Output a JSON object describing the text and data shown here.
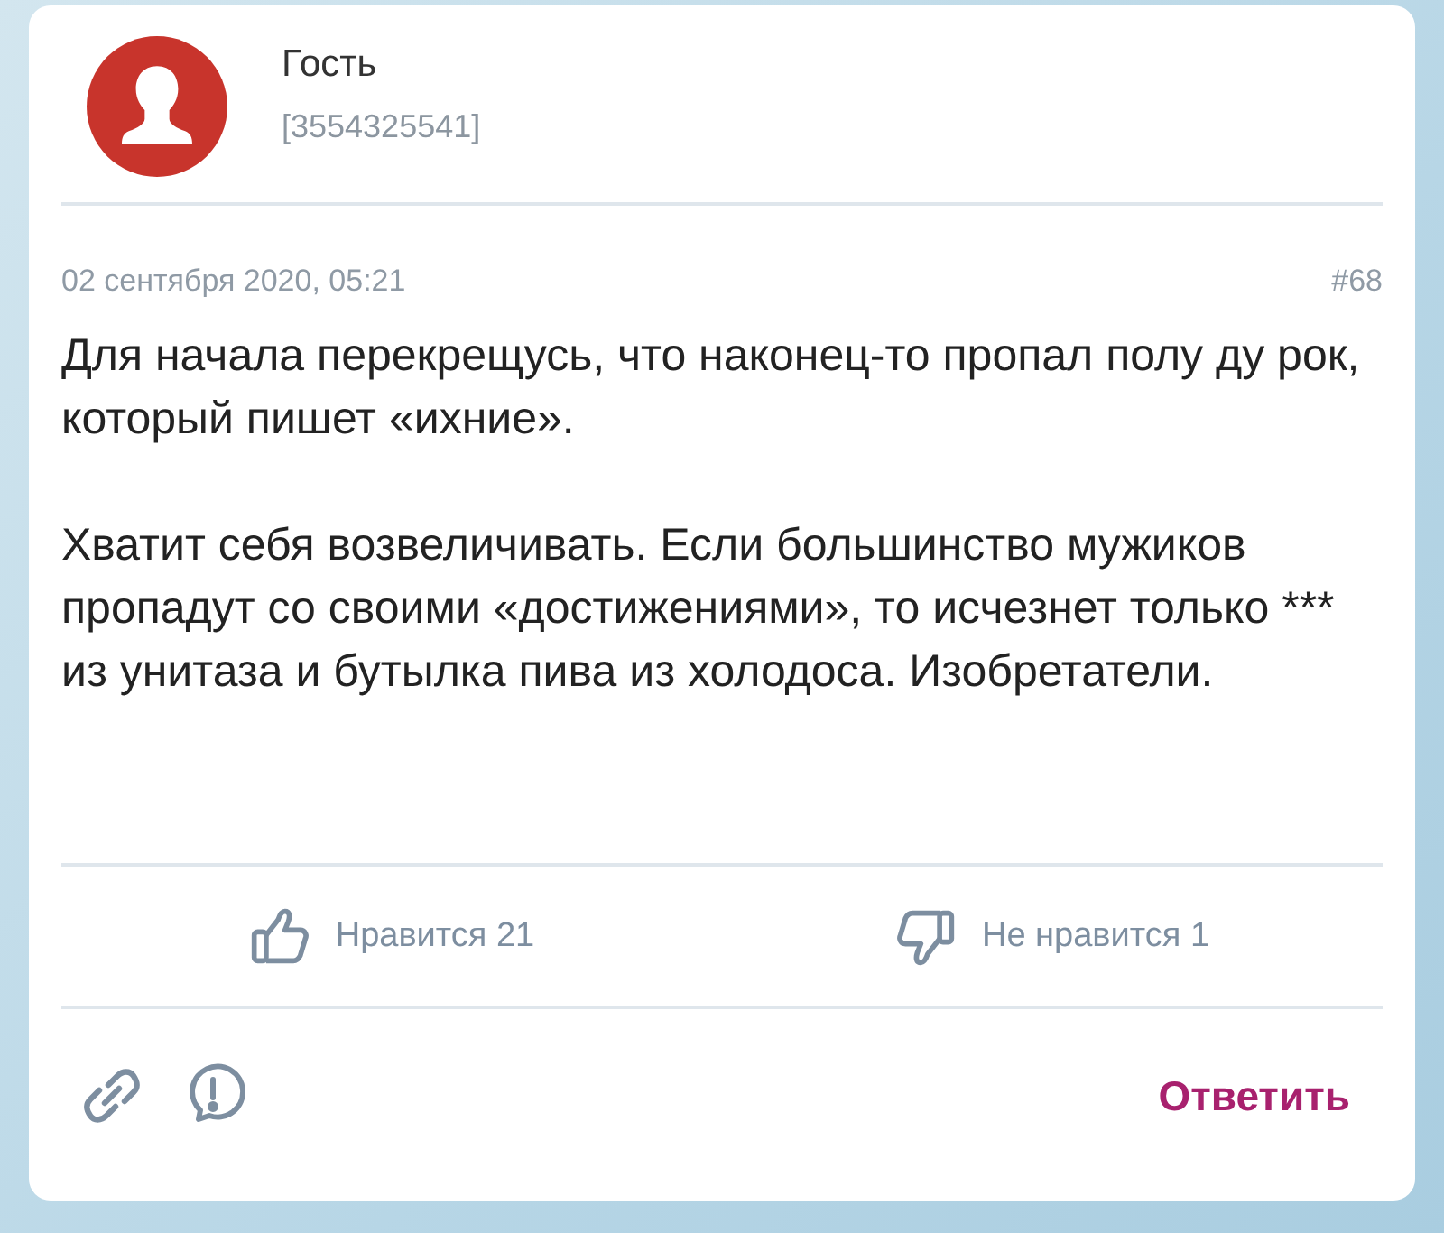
{
  "author": {
    "name": "Гость",
    "id": "[3554325541]"
  },
  "post": {
    "date": "02 сентября 2020, 05:21",
    "number": "#68",
    "paragraphs": [
      "Для начала перекрещусь, что наконец-то пропал полу ду рок, который пишет «ихние».",
      "Хватит себя возвеличивать. Если большинство мужиков пропадут со своими «достижениями», то исчезнет только *** из унитаза и бутылка пива из холодоса. Изобретатели."
    ]
  },
  "reactions": {
    "like": "Нравится 21",
    "dislike": "Не нравится 1"
  },
  "reply_button": "Ответить"
}
